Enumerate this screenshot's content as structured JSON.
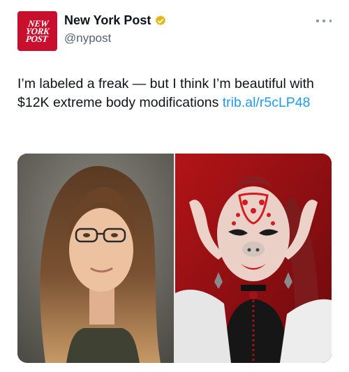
{
  "account": {
    "avatar_text": [
      "NEW",
      "YORK",
      "POST"
    ],
    "display_name": "New York Post",
    "handle": "@nypost",
    "verified_badge": "verified-gold-badge"
  },
  "tweet": {
    "text": "I’m labeled a freak — but I think I’m beautiful with $12K extreme body modifications ",
    "link_text": "trib.al/r5cLP48"
  },
  "colors": {
    "brand_red": "#c8102e",
    "link_blue": "#1d9bf0",
    "verified_gold": "#e2b719",
    "handle_gray": "#536471"
  },
  "icons": {
    "more": "more-icon",
    "verified": "verified-icon"
  }
}
